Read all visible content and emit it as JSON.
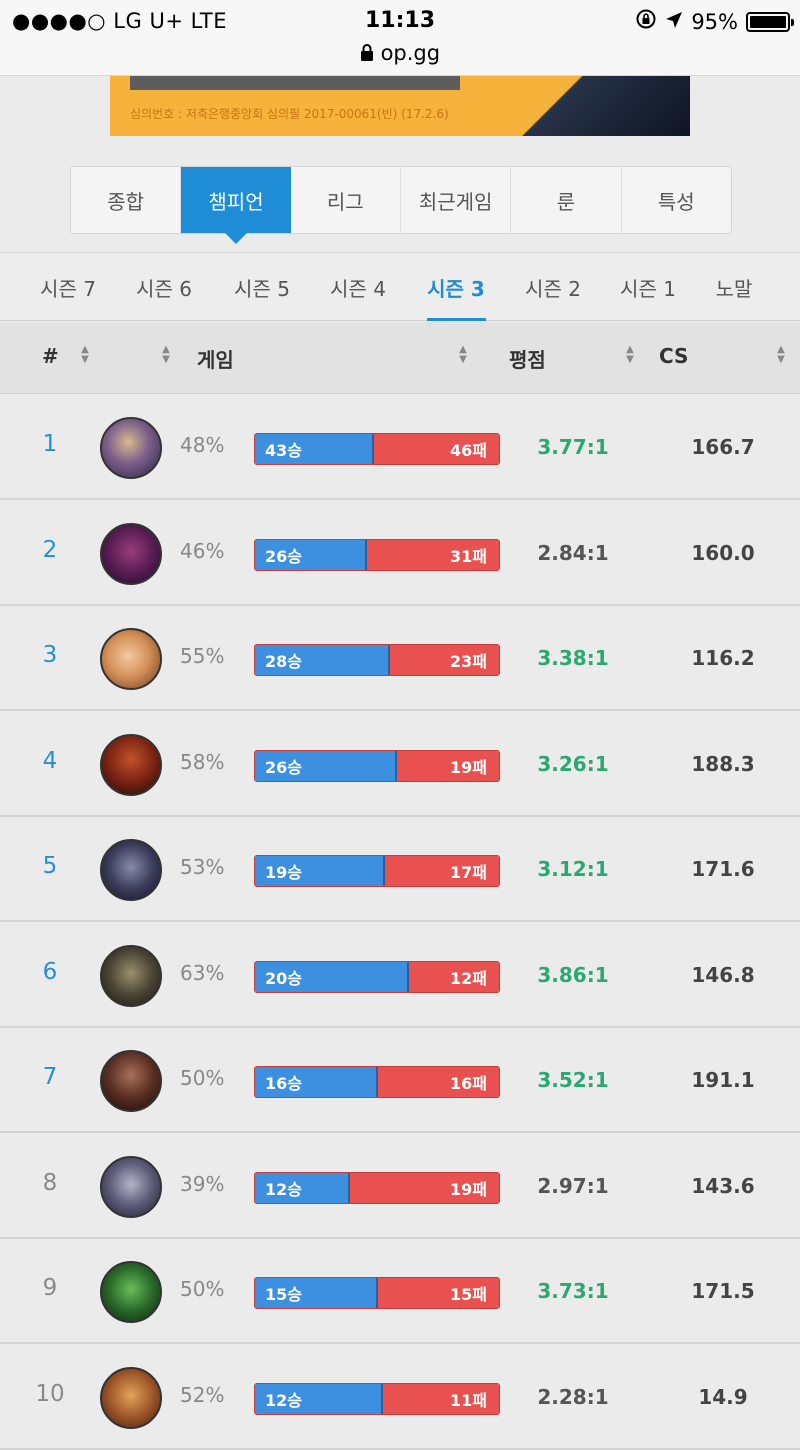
{
  "status_bar": {
    "carrier": "●●●●○ LG U+  LTE",
    "time": "11:13",
    "url": "op.gg",
    "battery": "95%"
  },
  "ad": {
    "legal_text": "심의번호 : 저축은행중앙회 심의필 2017-00061(빈) (17.2.6)"
  },
  "main_tabs": [
    {
      "label": "종합",
      "active": false
    },
    {
      "label": "챔피언",
      "active": true
    },
    {
      "label": "리그",
      "active": false
    },
    {
      "label": "최근게임",
      "active": false
    },
    {
      "label": "룬",
      "active": false
    },
    {
      "label": "특성",
      "active": false
    }
  ],
  "season_tabs": [
    {
      "label": "시즌 7",
      "active": false
    },
    {
      "label": "시즌 6",
      "active": false
    },
    {
      "label": "시즌 5",
      "active": false
    },
    {
      "label": "시즌 4",
      "active": false
    },
    {
      "label": "시즌 3",
      "active": true
    },
    {
      "label": "시즌 2",
      "active": false
    },
    {
      "label": "시즌 1",
      "active": false
    },
    {
      "label": "노말",
      "active": false
    }
  ],
  "table": {
    "headers": {
      "rank": "#",
      "games": "게임",
      "kda": "평점",
      "cs": "CS"
    },
    "rows": [
      {
        "rank": "1",
        "winrate": "48%",
        "wins": 43,
        "losses": 46,
        "win_label": "43승",
        "loss_label": "46패",
        "kda": "3.77:1",
        "kda_high": true,
        "cs": "166.7"
      },
      {
        "rank": "2",
        "winrate": "46%",
        "wins": 26,
        "losses": 31,
        "win_label": "26승",
        "loss_label": "31패",
        "kda": "2.84:1",
        "kda_high": false,
        "cs": "160.0"
      },
      {
        "rank": "3",
        "winrate": "55%",
        "wins": 28,
        "losses": 23,
        "win_label": "28승",
        "loss_label": "23패",
        "kda": "3.38:1",
        "kda_high": true,
        "cs": "116.2"
      },
      {
        "rank": "4",
        "winrate": "58%",
        "wins": 26,
        "losses": 19,
        "win_label": "26승",
        "loss_label": "19패",
        "kda": "3.26:1",
        "kda_high": true,
        "cs": "188.3"
      },
      {
        "rank": "5",
        "winrate": "53%",
        "wins": 19,
        "losses": 17,
        "win_label": "19승",
        "loss_label": "17패",
        "kda": "3.12:1",
        "kda_high": true,
        "cs": "171.6"
      },
      {
        "rank": "6",
        "winrate": "63%",
        "wins": 20,
        "losses": 12,
        "win_label": "20승",
        "loss_label": "12패",
        "kda": "3.86:1",
        "kda_high": true,
        "cs": "146.8"
      },
      {
        "rank": "7",
        "winrate": "50%",
        "wins": 16,
        "losses": 16,
        "win_label": "16승",
        "loss_label": "16패",
        "kda": "3.52:1",
        "kda_high": true,
        "cs": "191.1"
      },
      {
        "rank": "8",
        "winrate": "39%",
        "wins": 12,
        "losses": 19,
        "win_label": "12승",
        "loss_label": "19패",
        "kda": "2.97:1",
        "kda_high": false,
        "cs": "143.6"
      },
      {
        "rank": "9",
        "winrate": "50%",
        "wins": 15,
        "losses": 15,
        "win_label": "15승",
        "loss_label": "15패",
        "kda": "3.73:1",
        "kda_high": true,
        "cs": "171.5"
      },
      {
        "rank": "10",
        "winrate": "52%",
        "wins": 12,
        "losses": 11,
        "win_label": "12승",
        "loss_label": "11패",
        "kda": "2.28:1",
        "kda_high": false,
        "cs": "14.9"
      }
    ]
  },
  "colors": {
    "accent": "#1f8dd6",
    "win": "#3d8fe0",
    "loss": "#e8514f",
    "kda_good": "#2aa872"
  }
}
